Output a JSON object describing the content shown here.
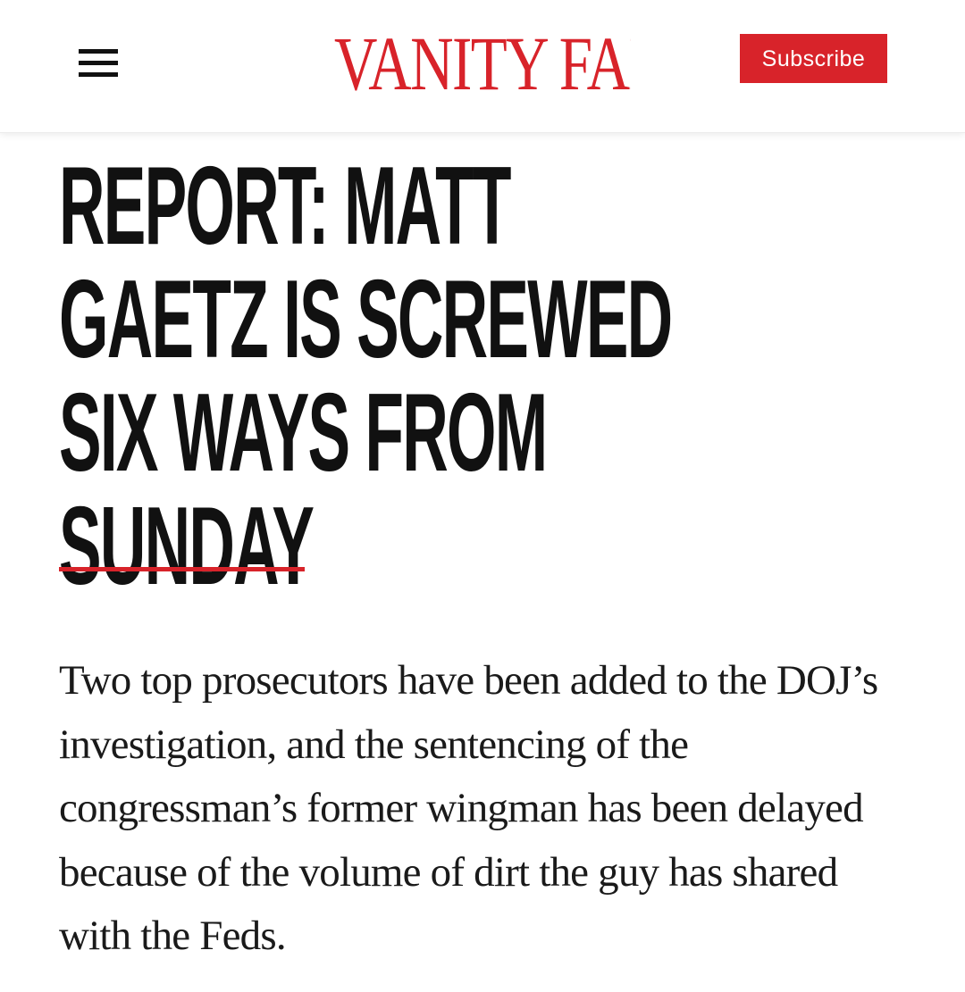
{
  "header": {
    "logo_text": "VANITY FAIR",
    "subscribe_label": "Subscribe",
    "menu_icon": "hamburger-menu-icon"
  },
  "article": {
    "headline": "REPORT: MATT GAETZ IS SCREWED SIX WAYS FROM SUNDAY",
    "dek": "Two top prosecutors have been added to the DOJ’s investigation, and the sentencing of the congressman’s former wingman has been delayed because of the volume of dirt the guy has shared with the Feds."
  },
  "colors": {
    "brand_red": "#d8232a",
    "text": "#111111",
    "background": "#ffffff"
  }
}
